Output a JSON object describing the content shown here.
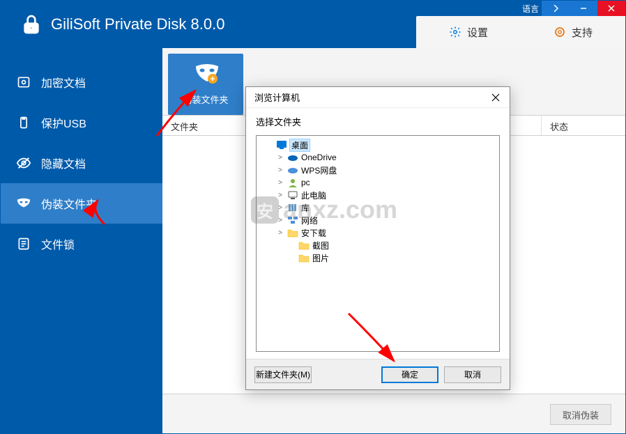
{
  "app_title": "GiliSoft Private Disk 8.0.0",
  "lang_label": "语言",
  "top_tabs": {
    "settings": "设置",
    "support": "支持"
  },
  "sidebar": {
    "items": [
      {
        "label": "加密文档"
      },
      {
        "label": "保护USB"
      },
      {
        "label": "隐藏文档"
      },
      {
        "label": "伪装文件夹"
      },
      {
        "label": "文件锁"
      }
    ]
  },
  "tab_header_label": "伪装文件夹",
  "grid": {
    "col_folder": "文件夹",
    "col_status": "状态"
  },
  "footer_cancel_disguise": "取消伪装",
  "dialog": {
    "title": "浏览计算机",
    "select_label": "选择文件夹",
    "tree": [
      {
        "indent": 0,
        "toggle": "",
        "icon": "desktop",
        "label": "桌面",
        "selected": true
      },
      {
        "indent": 1,
        "toggle": ">",
        "icon": "onedrive",
        "label": "OneDrive"
      },
      {
        "indent": 1,
        "toggle": ">",
        "icon": "wps",
        "label": "WPS网盘"
      },
      {
        "indent": 1,
        "toggle": ">",
        "icon": "user",
        "label": "pc"
      },
      {
        "indent": 1,
        "toggle": ">",
        "icon": "pc",
        "label": "此电脑"
      },
      {
        "indent": 1,
        "toggle": ">",
        "icon": "lib",
        "label": "库"
      },
      {
        "indent": 1,
        "toggle": ">",
        "icon": "net",
        "label": "网络"
      },
      {
        "indent": 1,
        "toggle": ">",
        "icon": "folder",
        "label": "安下载"
      },
      {
        "indent": 2,
        "toggle": "",
        "icon": "folder",
        "label": "截图"
      },
      {
        "indent": 2,
        "toggle": "",
        "icon": "folder",
        "label": "图片"
      }
    ],
    "btn_new_folder": "新建文件夹(M)",
    "btn_ok": "确定",
    "btn_cancel": "取消"
  },
  "watermark": {
    "badge": "安",
    "text": "anxz.com"
  }
}
